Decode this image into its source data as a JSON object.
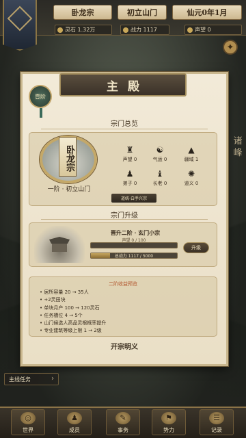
{
  "header": {
    "sect_name": "卧龙宗",
    "sect_rank": "初立山门",
    "date": "仙元0年1月",
    "stats": [
      {
        "label": "灵石 1.32万",
        "icon": "spirit-stone-icon"
      },
      {
        "label": "战力 1117",
        "icon": "power-icon"
      },
      {
        "label": "声望 0",
        "icon": "prestige-icon"
      }
    ]
  },
  "side_text": "诸峰",
  "panel": {
    "title": "主殿",
    "rank_badge": "壹阶",
    "overview_title": "宗门总览",
    "emblem_name": "卧龙宗",
    "sect_level": "一阶 · 初立山门",
    "attributes": [
      {
        "label": "声望 0",
        "icon": "prestige-icon",
        "glyph": "♜"
      },
      {
        "label": "气运 0",
        "icon": "fortune-icon",
        "glyph": "☯"
      },
      {
        "label": "疆域 1",
        "icon": "territory-icon",
        "glyph": "▲"
      },
      {
        "label": "弟子 0",
        "icon": "disciple-icon",
        "glyph": "♟"
      },
      {
        "label": "长老 0",
        "icon": "elder-icon",
        "glyph": "♝"
      },
      {
        "label": "道义 0",
        "icon": "dao-icon",
        "glyph": "✺"
      }
    ],
    "tag_button": "道统·白手兴宗",
    "upgrade_title": "宗门升级",
    "upgrade_target": "晋升二阶 · 玄门小宗",
    "prestige_progress": {
      "label": "声望 0 / 100",
      "value": 0,
      "max": 100
    },
    "power_progress": {
      "label": "总战力 1117 / 5000",
      "value": 1117,
      "max": 5000
    },
    "upgrade_button": "升级",
    "preview_title": "二阶收益预览",
    "preview_items": [
      "居所容量 20 → 35人",
      "+2灵田块",
      "单块月产 100 → 120灵石",
      "任务槽位 4 → 5个",
      "山门候选人高品灵根概率提升",
      "专业建筑等级上限 1 → 2级"
    ],
    "footer_title": "开宗明义"
  },
  "mission_button": "主线任务",
  "speed_controls": [
    {
      "label": "❚❚",
      "name": "pause-button",
      "active": true
    },
    {
      "label": "▶",
      "name": "play-button",
      "active": false
    },
    {
      "label": "▶▶",
      "name": "fast-forward-button",
      "active": false
    }
  ],
  "nav": [
    {
      "label": "世界",
      "icon": "world-icon",
      "glyph": "◎"
    },
    {
      "label": "成员",
      "icon": "members-icon",
      "glyph": "♟"
    },
    {
      "label": "事务",
      "icon": "affairs-icon",
      "glyph": "✎"
    },
    {
      "label": "势力",
      "icon": "faction-icon",
      "glyph": "⚑"
    },
    {
      "label": "记录",
      "icon": "records-icon",
      "glyph": "☰"
    }
  ]
}
